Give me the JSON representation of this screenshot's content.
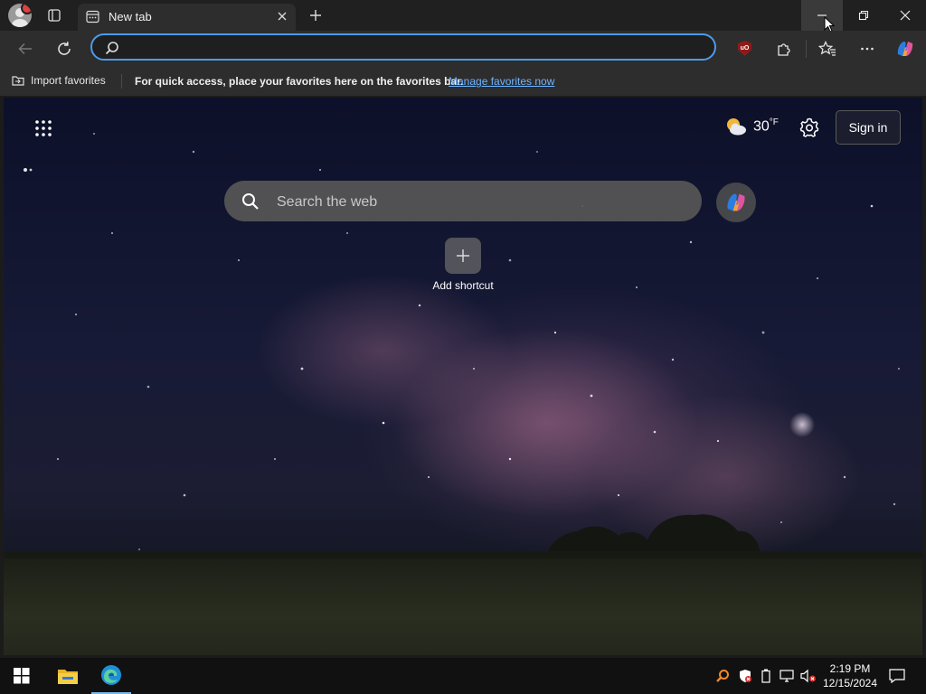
{
  "tab": {
    "title": "New tab"
  },
  "address_bar": {
    "value": "",
    "placeholder": ""
  },
  "favorites_bar": {
    "import_label": "Import favorites",
    "message": "For quick access, place your favorites here on the favorites bar.",
    "manage_link": "Manage favorites now"
  },
  "newtab": {
    "weather_temp": "30",
    "weather_unit": "°F",
    "sign_in": "Sign in",
    "search_placeholder": "Search the web",
    "shortcut_label": "Add shortcut"
  },
  "taskbar": {
    "time": "2:19 PM",
    "date": "12/15/2024",
    "pinned": [
      "file-explorer-icon",
      "edge-icon"
    ]
  },
  "colors": {
    "accent": "#4c9be8",
    "link": "#6db3ff",
    "titlebar": "#202020",
    "toolbar": "#2d2d2d"
  }
}
